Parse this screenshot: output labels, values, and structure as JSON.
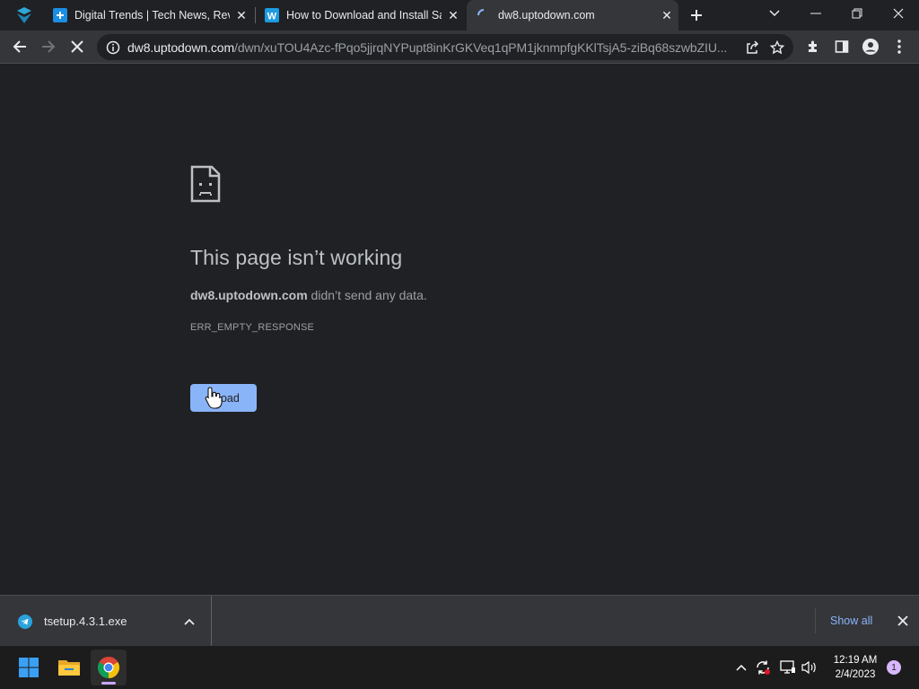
{
  "tabs": [
    {
      "title": "Digital Trends | Tech News, Reviews",
      "favicon": "digitaltrends-icon"
    },
    {
      "title": "How to Download and Install Safari",
      "favicon": "w-letter-icon"
    },
    {
      "title": "dw8.uptodown.com",
      "favicon": "loading-spinner-icon",
      "active": true
    }
  ],
  "toolbar": {
    "url_host": "dw8.uptodown.com",
    "url_path": "/dwn/xuTOU4Azc-fPqo5jjrqNYPupt8inKrGKVeq1qPM1jknmpfgKKlTsjA5-ziBq68szwbZIU..."
  },
  "error_page": {
    "title": "This page isn’t working",
    "host": "dw8.uptodown.com",
    "message_suffix": " didn’t send any data.",
    "code": "ERR_EMPTY_RESPONSE",
    "reload_label": "Reload",
    "reload_visible": "load"
  },
  "downloads": {
    "file_name": "tsetup.4.3.1.exe",
    "show_all_label": "Show all"
  },
  "taskbar": {
    "time": "12:19 AM",
    "date": "2/4/2023",
    "notification_count": "1"
  },
  "colors": {
    "accent": "#8ab4f8",
    "background": "#202124",
    "toolbar": "#35363a"
  }
}
